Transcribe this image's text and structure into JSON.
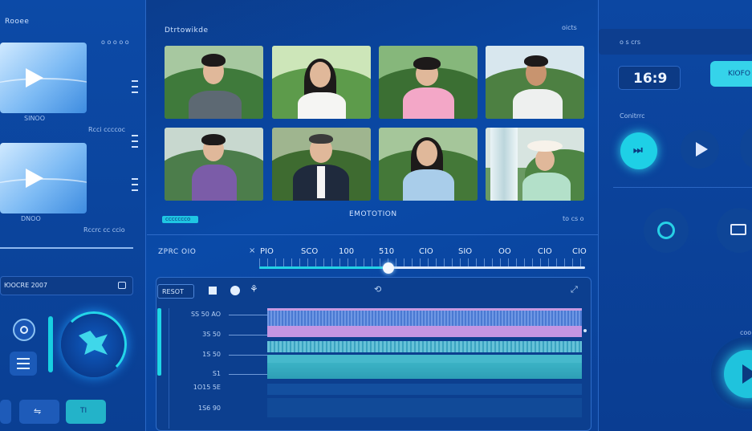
{
  "left": {
    "title": "Rooee",
    "top_right": "o o o o o",
    "clip1_label": "SINOO",
    "clip1_meta": "Rcci ccccoc",
    "clip2_label": "DNOO",
    "clip2_meta": "Rccrc cc ccio",
    "search_text": "ЮOCRE 2007",
    "bottom_btn_label": "TI"
  },
  "center": {
    "header": "Dtrtowikde",
    "header_right": "oicts",
    "badge": "ccccccco",
    "caption": "EMOTOTION",
    "caption_right": "to cs o",
    "timeline_label": "ZPRC OIO",
    "ticks": [
      "PIO",
      "SCO",
      "100",
      "510",
      "CIO",
      "SIO",
      "OO",
      "CIO",
      "CIO"
    ],
    "track_label_btn": "RESOT",
    "tracks": [
      "SS 50 AO",
      "3S 50",
      "1S 50",
      "S1",
      "1O15 5E",
      "1S6 90"
    ],
    "colors": {
      "accent": "#1fd6e6",
      "track_blue": "#5a8fe0",
      "track_purple": "#c391e0",
      "track_teal": "#37b7c9"
    }
  },
  "right": {
    "header": "o s crs",
    "ratio": "16:9",
    "cta": "KIOFO",
    "section": "Conitrrc",
    "bottom_text": "coo"
  }
}
